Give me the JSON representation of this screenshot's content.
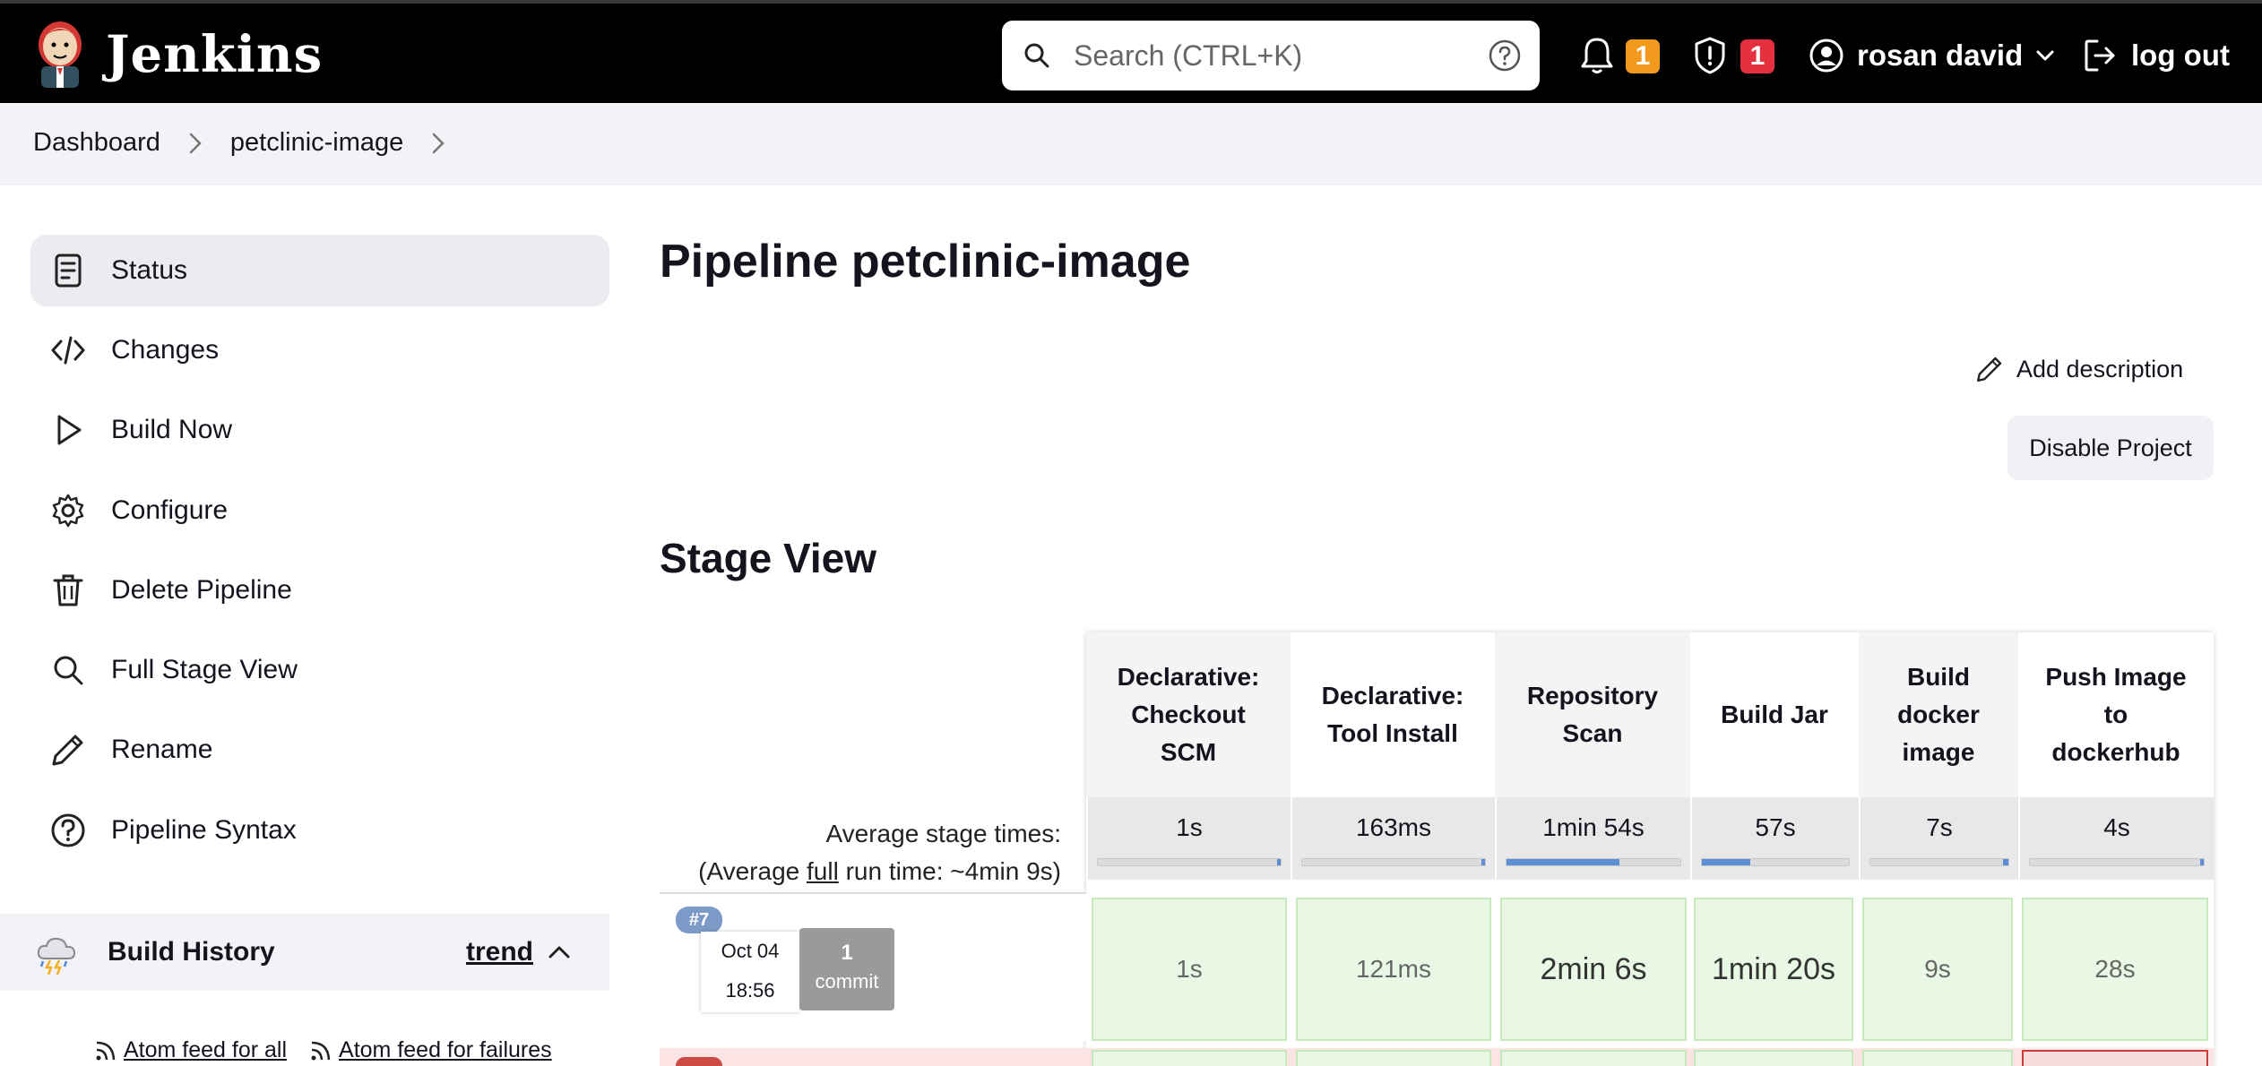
{
  "header": {
    "brand": "Jenkins",
    "search_placeholder": "Search (CTRL+K)",
    "notifications_count": "1",
    "security_count": "1",
    "user_name": "rosan david",
    "logout_label": "log out",
    "colors": {
      "bar": "#000000",
      "notify_badge": "#f39a1e",
      "security_badge": "#e6303f"
    }
  },
  "breadcrumb": [
    "Dashboard",
    "petclinic-image"
  ],
  "sidebar": {
    "items": [
      {
        "label": "Status",
        "icon": "document-icon",
        "active": true
      },
      {
        "label": "Changes",
        "icon": "code-icon"
      },
      {
        "label": "Build Now",
        "icon": "play-icon"
      },
      {
        "label": "Configure",
        "icon": "gear-icon"
      },
      {
        "label": "Delete Pipeline",
        "icon": "trash-icon"
      },
      {
        "label": "Full Stage View",
        "icon": "search-icon"
      },
      {
        "label": "Rename",
        "icon": "pencil-icon"
      },
      {
        "label": "Pipeline Syntax",
        "icon": "help-circle-icon"
      }
    ],
    "build_history": {
      "title": "Build History",
      "trend": "trend"
    },
    "feeds": {
      "all": "Atom feed for all",
      "failures": "Atom feed for failures"
    }
  },
  "main": {
    "title": "Pipeline petclinic-image",
    "add_description": "Add description",
    "disable_project": "Disable Project",
    "stage_view_title": "Stage View",
    "avg_label_1": "Average stage times:",
    "avg_label_2_prefix": "(Average ",
    "avg_label_2_link": "full",
    "avg_label_2_suffix": " run time: ~4min 9s)"
  },
  "stages": [
    {
      "name_lines": [
        "Declarative:",
        "Checkout",
        "SCM"
      ],
      "avg": "1s",
      "avg_fraction": 0.0
    },
    {
      "name_lines": [
        "Declarative:",
        "Tool Install"
      ],
      "avg": "163ms",
      "avg_fraction": 0.0
    },
    {
      "name_lines": [
        "Repository",
        "Scan"
      ],
      "avg": "1min 54s",
      "avg_fraction": 0.65
    },
    {
      "name_lines": [
        "Build Jar"
      ],
      "avg": "57s",
      "avg_fraction": 0.33
    },
    {
      "name_lines": [
        "Build",
        "docker",
        "image"
      ],
      "avg": "7s",
      "avg_fraction": 0.04
    },
    {
      "name_lines": [
        "Push Image",
        "to",
        "dockerhub"
      ],
      "avg": "4s",
      "avg_fraction": 0.02
    }
  ],
  "runs": [
    {
      "number": "#7",
      "date": "Oct 04",
      "time": "18:56",
      "commits": "1",
      "commit_label": "commit",
      "durations": [
        "1s",
        "121ms",
        "2min 6s",
        "1min 20s",
        "9s",
        "28s"
      ]
    }
  ]
}
